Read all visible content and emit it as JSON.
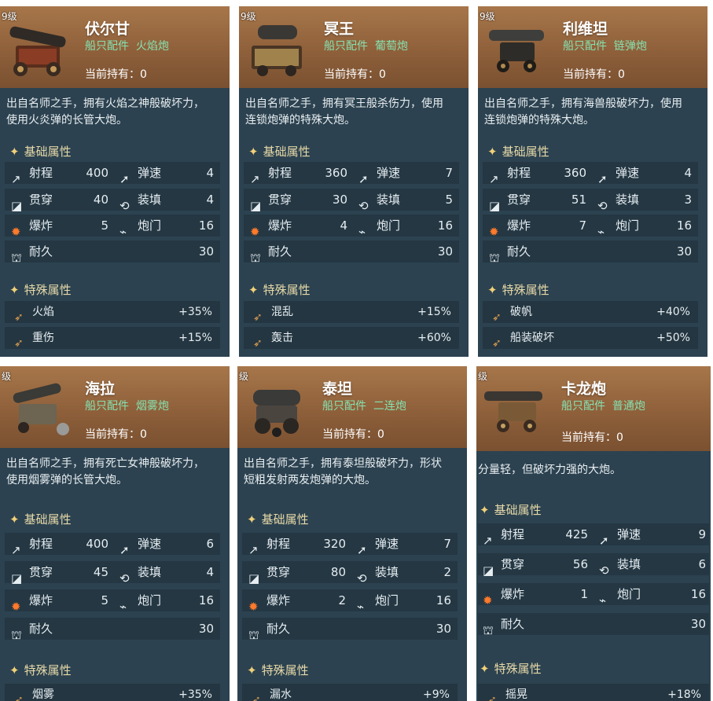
{
  "common": {
    "subtitle_prefix": "船只配件",
    "holding_label": "当前持有：0",
    "basic_section": "基础属性",
    "special_section": "特殊属性",
    "level": "9级",
    "level_partial": "级",
    "stats": {
      "range": "射程",
      "speed": "弹速",
      "pierce": "贯穿",
      "reload": "装填",
      "explode": "爆炸",
      "ports": "炮门",
      "durability": "耐久"
    }
  },
  "cards": [
    {
      "name": "伏尔甘",
      "type": "火焰炮",
      "desc": "出自名师之手，拥有火焰之神般破坏力，使用火炎弹的长管大炮。",
      "range": "400",
      "speed": "4",
      "pierce": "40",
      "reload": "4",
      "explode": "5",
      "ports": "16",
      "durability": "30",
      "special": [
        {
          "label": "火焰",
          "value": "+35%"
        },
        {
          "label": "重伤",
          "value": "+15%"
        }
      ]
    },
    {
      "name": "冥王",
      "type": "葡萄炮",
      "desc": "出自名师之手，拥有冥王般杀伤力，使用连锁炮弹的特殊大炮。",
      "range": "360",
      "speed": "7",
      "pierce": "30",
      "reload": "5",
      "explode": "4",
      "ports": "16",
      "durability": "30",
      "special": [
        {
          "label": "混乱",
          "value": "+15%"
        },
        {
          "label": "轰击",
          "value": "+60%"
        }
      ]
    },
    {
      "name": "利维坦",
      "type": "链弹炮",
      "desc": "出自名师之手，拥有海兽般破坏力，使用连锁炮弹的特殊大炮。",
      "range": "360",
      "speed": "4",
      "pierce": "51",
      "reload": "3",
      "explode": "7",
      "ports": "16",
      "durability": "30",
      "special": [
        {
          "label": "破帆",
          "value": "+40%"
        },
        {
          "label": "船装破坏",
          "value": "+50%"
        }
      ]
    },
    {
      "name": "海拉",
      "type": "烟雾炮",
      "desc": "出自名师之手，拥有死亡女神般破坏力，使用烟雾弹的长管大炮。",
      "range": "400",
      "speed": "6",
      "pierce": "45",
      "reload": "4",
      "explode": "5",
      "ports": "16",
      "durability": "30",
      "special": [
        {
          "label": "烟雾",
          "value": "+35%"
        }
      ]
    },
    {
      "name": "泰坦",
      "type": "二连炮",
      "desc": "出自名师之手，拥有泰坦般破坏力，形状短粗发射两发炮弹的大炮。",
      "range": "320",
      "speed": "7",
      "pierce": "80",
      "reload": "2",
      "explode": "2",
      "ports": "16",
      "durability": "30",
      "special": [
        {
          "label": "漏水",
          "value": "+9%"
        }
      ]
    },
    {
      "name": "卡龙炮",
      "type": "普通炮",
      "desc": "分量轻，但破坏力强的大炮。",
      "range": "425",
      "speed": "9",
      "pierce": "56",
      "reload": "6",
      "explode": "1",
      "ports": "16",
      "durability": "30",
      "special": [
        {
          "label": "摇晃",
          "value": "+18%"
        }
      ]
    }
  ],
  "colors": {
    "card_bg": "#2c4250",
    "header": "#8c5e39",
    "subtitle": "#86e0b0",
    "section": "#e7d9a8"
  }
}
